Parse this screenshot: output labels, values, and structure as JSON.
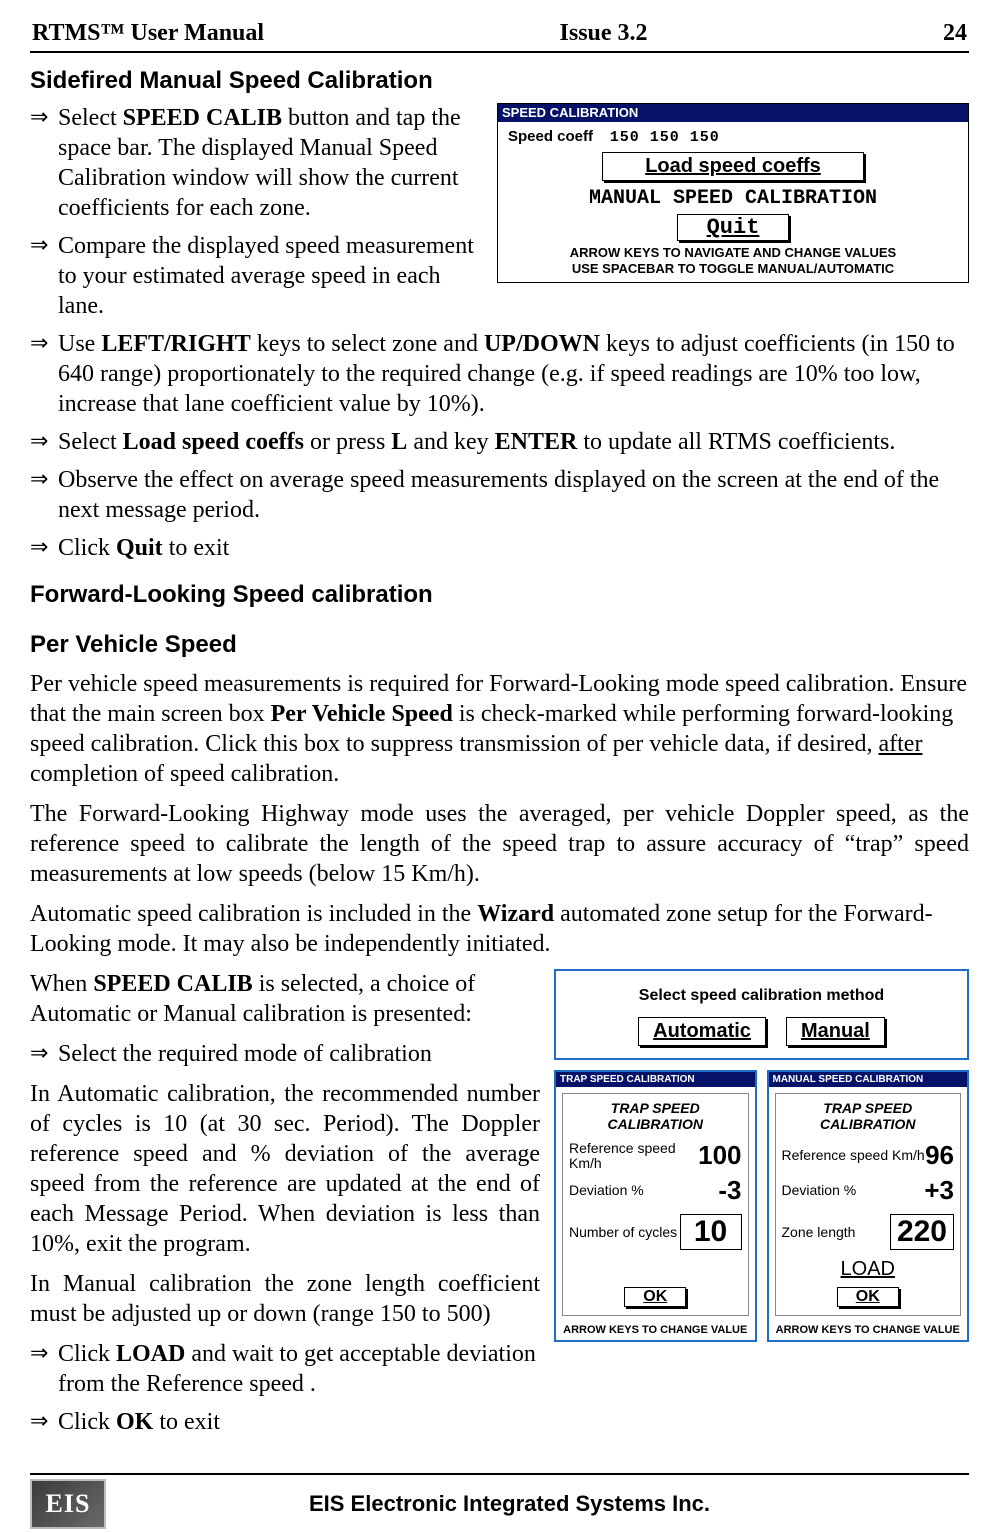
{
  "header": {
    "left": "RTMS™ User Manual",
    "center": "Issue 3.2",
    "right": "24"
  },
  "sec1": {
    "title": "Sidefired Manual Speed Calibration",
    "li1_a": "Select ",
    "li1_b": "SPEED CALIB",
    "li1_c": " button and tap the space bar. The displayed Manual Speed Calibration window will show the  current coefficients for each zone.",
    "li2": "Compare the displayed speed measurement to your estimated average speed in each lane.",
    "li3_a": "Use ",
    "li3_b": "LEFT/RIGHT",
    "li3_c": " keys to select zone and ",
    "li3_d": "UP/DOWN",
    "li3_e": " keys to adjust coefficients (in 150 to 640 range) proportionately to the required change (e.g. if speed readings are 10% too low, increase that lane coefficient value by 10%).",
    "li4_a": "Select ",
    "li4_b": "Load speed coeffs",
    "li4_c": " or press ",
    "li4_d": "L",
    "li4_e": " and key ",
    "li4_f": "ENTER",
    "li4_g": " to update all RTMS coefficients.",
    "li5": "Observe the effect on average speed measurements displayed on the screen at the end of the next message period.",
    "li6_a": "Click ",
    "li6_b": "Quit",
    "li6_c": " to exit"
  },
  "fig1": {
    "titlebar": "SPEED CALIBRATION",
    "coeff_label": "Speed coeff",
    "coeffs": "150 150 150",
    "btn_load": "Load speed coeffs",
    "manual_line": "MANUAL SPEED CALIBRATION",
    "btn_quit": "Quit",
    "help1": "ARROW KEYS TO NAVIGATE AND CHANGE VALUES",
    "help2": "USE SPACEBAR TO TOGGLE MANUAL/AUTOMATIC"
  },
  "sec2": {
    "title": "Forward-Looking Speed calibration"
  },
  "sec3": {
    "title": "Per Vehicle Speed",
    "p1_a": "Per vehicle speed measurements is required for Forward-Looking mode speed calibration.  Ensure that the main screen box ",
    "p1_b": "Per Vehicle Speed",
    "p1_c": " is check-marked while performing forward-looking speed calibration.   Click this box to suppress transmission of per vehicle data, if desired, ",
    "p1_d": "after",
    "p1_e": " completion of speed calibration.",
    "p2": "The Forward-Looking Highway mode uses the averaged, per vehicle Doppler speed, as the reference speed to calibrate the length of the speed trap to assure accuracy of “trap” speed measurements at low speeds (below 15 Km/h).",
    "p3_a": "Automatic speed calibration is included in the ",
    "p3_b": "Wizard",
    "p3_c": " automated zone setup for the Forward-Looking mode.  It may also be independently initiated.",
    "p4_a": "When ",
    "p4_b": "SPEED CALIB",
    "p4_c": " is selected, a choice of Automatic or Manual calibration is presented:",
    "li1": "Select the required mode of calibration",
    "p5": "In Automatic calibration, the recommended number of cycles is 10 (at 30 sec. Period). The Doppler reference speed and % deviation of the average speed from the reference are updated at the end of each Message Period. When deviation is less than 10%, exit the program.",
    "p6": "In Manual calibration the zone length coefficient must be adjusted up or down (range 150 to 500)",
    "li2_a": "Click ",
    "li2_b": "LOAD",
    "li2_c": " and wait to get acceptable deviation from the Reference speed .",
    "li3_a": "Click ",
    "li3_b": "OK",
    "li3_c": " to exit"
  },
  "fig2": {
    "select_title": "Select speed calibration method",
    "btn_auto": "Automatic",
    "btn_manual": "Manual",
    "left": {
      "bar": "TRAP SPEED CALIBRATION",
      "sub": "TRAP SPEED CALIBRATION",
      "ref_lbl": "Reference speed Km/h",
      "ref_val": "100",
      "dev_lbl": "Deviation %",
      "dev_val": "-3",
      "cycles_lbl": "Number of cycles",
      "cycles_val": "10",
      "ok": "OK",
      "foot": "ARROW KEYS TO CHANGE VALUE"
    },
    "right": {
      "bar": "MANUAL SPEED CALIBRATION",
      "sub": "TRAP SPEED CALIBRATION",
      "ref_lbl": "Reference speed Km/h",
      "ref_val": "96",
      "dev_lbl": "Deviation %",
      "dev_val": "+3",
      "len_lbl": "Zone length",
      "len_val": "220",
      "load": "LOAD",
      "ok": "OK",
      "foot": "ARROW KEYS TO CHANGE VALUE"
    }
  },
  "footer": {
    "logo": "EIS",
    "text": "EIS Electronic Integrated Systems Inc."
  }
}
